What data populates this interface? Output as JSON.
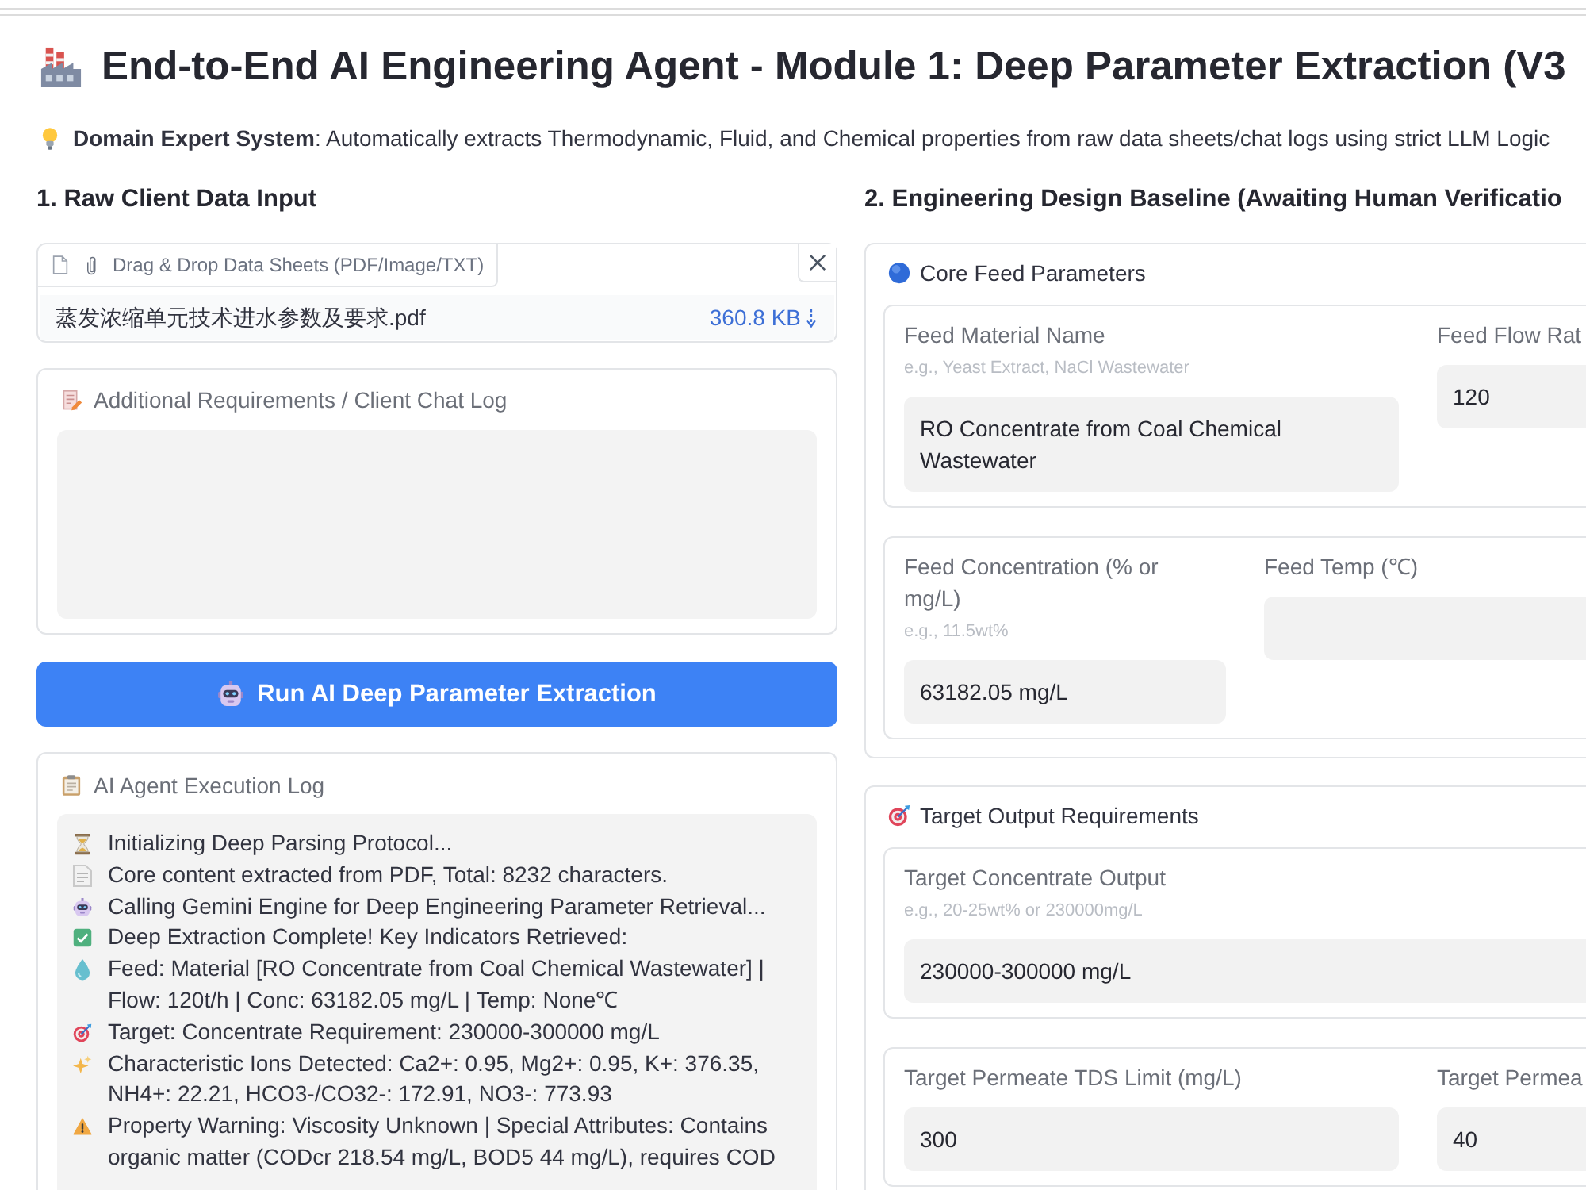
{
  "header": {
    "title": "End-to-End AI Engineering Agent - Module 1: Deep Parameter Extraction (V3",
    "intro": "**Domain Expert System**: Automatically extracts Thermodynamic, Fluid, and Chemical properties from raw data sheets/chat logs using strict LLM Logic"
  },
  "input_panel": {
    "heading": "1. Raw Client Data Input",
    "upload": {
      "label": "Drag & Drop Data Sheets (PDF/Image/TXT)",
      "file_name": "蒸发浓缩单元技术进水参数及要求.pdf",
      "file_size": "360.8 KB"
    },
    "requirements": {
      "label": "Additional Requirements / Client Chat Log"
    },
    "run_button": "Run AI Deep Parameter Extraction",
    "log": {
      "label": "AI Agent Execution Log",
      "entries": [
        {
          "kind": "progress",
          "text": "Initializing Deep Parsing Protocol..."
        },
        {
          "kind": "extract",
          "text": "Core content extracted from PDF, Total: 8232 characters."
        },
        {
          "kind": "engine",
          "text": "Calling Gemini Engine for Deep Engineering Parameter Retrieval..."
        },
        {
          "kind": "success",
          "text": "Deep Extraction Complete! Key Indicators Retrieved:"
        },
        {
          "kind": "feed",
          "text": "Feed: Material [RO Concentrate from Coal Chemical Wastewater] | Flow: 120t/h | Conc: 63182.05 mg/L | Temp: None℃"
        },
        {
          "kind": "target",
          "text": "Target: Concentrate Requirement: 230000-300000 mg/L"
        },
        {
          "kind": "ions",
          "text": "Characteristic Ions Detected: Ca2+: 0.95, Mg2+: 0.95, K+: 376.35, NH4+: 22.21, HCO3-/CO32-: 172.91, NO3-: 773.93"
        },
        {
          "kind": "warning",
          "text": "Property Warning: Viscosity Unknown | Special Attributes: Contains organic matter (CODcr 218.54 mg/L, BOD5 44 mg/L), requires COD"
        }
      ]
    }
  },
  "baseline_panel": {
    "heading": "2. Engineering Design Baseline (Awaiting Human Verificatio",
    "cards": [
      {
        "kind": "feed",
        "title": "Core Feed Parameters",
        "groups": [
          {
            "fields": [
              {
                "label": "Feed Material Name",
                "info": "e.g., Yeast Extract, NaCl Wastewater",
                "value": "RO Concentrate from Coal Chemical Wastewater"
              },
              {
                "label": "Feed Flow Rat",
                "value": "120"
              }
            ]
          },
          {
            "fields": [
              {
                "label": "Feed Concentration (% or mg/L)",
                "info": "e.g., 11.5wt%",
                "value": "63182.05 mg/L"
              },
              {
                "label": "Feed Temp (℃)"
              }
            ]
          }
        ]
      },
      {
        "kind": "target",
        "title": "Target Output Requirements",
        "groups": [
          {
            "fields": [
              {
                "label": "Target Concentrate Output",
                "info": "e.g., 20-25wt% or 230000mg/L",
                "value": "230000-300000 mg/L"
              }
            ]
          },
          {
            "fields": [
              {
                "label": "Target Permeate TDS Limit (mg/L)",
                "value": "300"
              },
              {
                "label": "Target Permea",
                "value": "40"
              }
            ]
          }
        ]
      }
    ]
  }
}
